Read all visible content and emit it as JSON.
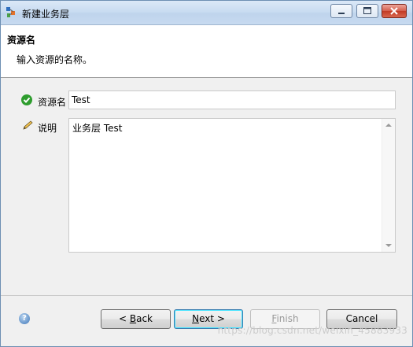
{
  "window": {
    "title": "新建业务层"
  },
  "banner": {
    "title": "资源名",
    "description": "输入资源的名称。"
  },
  "form": {
    "name_label": "资源名",
    "name_value": "Test",
    "description_label": "说明",
    "description_value": "业务层 Test"
  },
  "buttons": {
    "back_prefix": "< ",
    "back_key": "B",
    "back_rest": "ack",
    "next_key": "N",
    "next_rest": "ext >",
    "finish_key": "F",
    "finish_rest": "inish",
    "cancel": "Cancel"
  },
  "help": {
    "glyph": "?"
  },
  "watermark": "https://blog.csdn.net/weixin_45883933",
  "colors": {
    "accent": "#3c7fb1",
    "ok_icon": "#2e9d2e",
    "close_button": "#c23a24"
  }
}
